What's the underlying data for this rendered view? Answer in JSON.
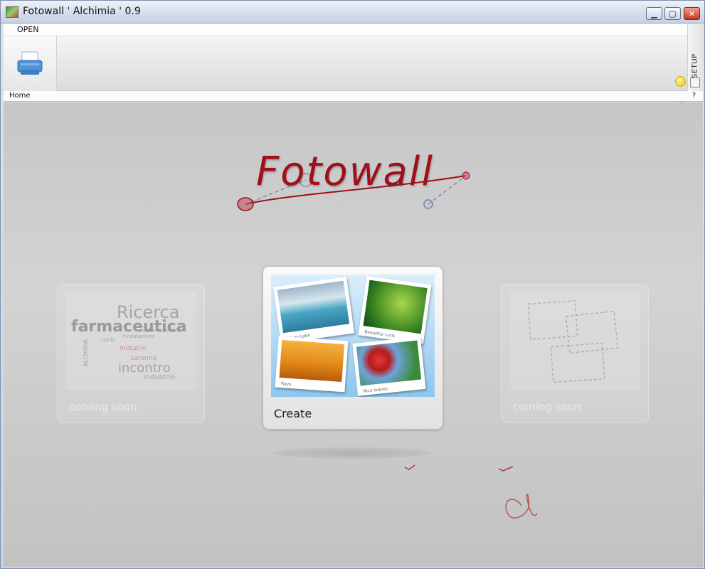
{
  "window": {
    "title": "Fotowall ' Alchimia ' 0.9",
    "controls": {
      "minimize": "▁",
      "maximize": "▢",
      "close": "✕"
    }
  },
  "menu": {
    "open_label": "OPEN"
  },
  "side_panel": {
    "setup_label": "SETUP",
    "icons": [
      "smiley-icon",
      "bulb-icon",
      "window-icon"
    ]
  },
  "statusbar": {
    "breadcrumb": "Home",
    "help": "?"
  },
  "canvas": {
    "logo_text": "Fotowall",
    "cards": [
      {
        "id": "left",
        "label": "coming soon",
        "state": "disabled",
        "wordcloud": [
          "Ricerca",
          "farmaceutica",
          "ALCHIMIA",
          "incontro",
          "industrie",
          "ruolo",
          "mutativi",
          "saranno",
          "rivalutazione",
          "nuove molecole"
        ]
      },
      {
        "id": "center",
        "label": "Create",
        "state": "active",
        "photos": [
          "Ice on Lake",
          "Beautiful curls",
          "Rays",
          "Nice leaves"
        ]
      },
      {
        "id": "right",
        "label": "coming soon",
        "state": "disabled"
      }
    ]
  },
  "colors": {
    "logo": "#a0101a",
    "accent_blue": "#5a9bd5",
    "canvas_gray": "#c6c6c6"
  }
}
